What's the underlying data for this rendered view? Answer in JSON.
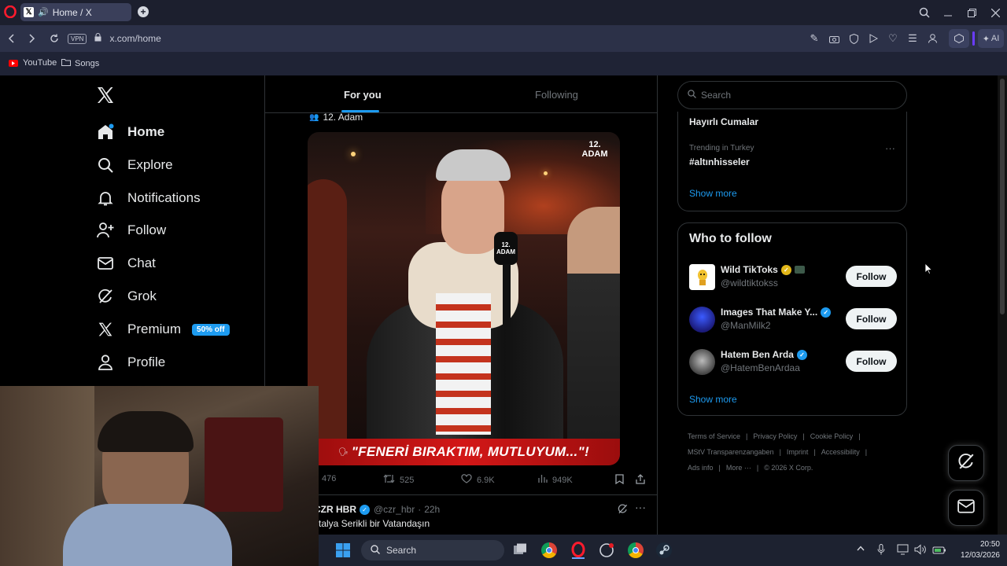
{
  "browser": {
    "tab_title": "Home / X",
    "url": "x.com/home",
    "vpn_label": "VPN",
    "ai_label": "AI",
    "bookmarks": [
      "YouTube",
      "Songs"
    ]
  },
  "sidebar": {
    "items": [
      {
        "label": "Home",
        "icon": "home-icon"
      },
      {
        "label": "Explore",
        "icon": "search-icon"
      },
      {
        "label": "Notifications",
        "icon": "bell-icon"
      },
      {
        "label": "Follow",
        "icon": "follow-icon"
      },
      {
        "label": "Chat",
        "icon": "mail-icon"
      },
      {
        "label": "Grok",
        "icon": "grok-icon"
      },
      {
        "label": "Premium",
        "icon": "x-icon"
      },
      {
        "label": "Profile",
        "icon": "person-icon"
      }
    ],
    "premium_badge": "50% off"
  },
  "timeline": {
    "tabs": [
      "For you",
      "Following"
    ],
    "post": {
      "author_header": "12. Adam",
      "video_caption": "\"FENERİ BIRAKTIM, MUTLUYUM...\"!",
      "video_logo": "12. ADAM",
      "mic_logo": "12. ADAM",
      "replies": "476",
      "reposts": "525",
      "likes": "6.9K",
      "views": "949K"
    },
    "next_post": {
      "name": "CZR HBR",
      "handle": "@czr_hbr",
      "time": "22h",
      "text": "talya Serikli bir Vatandaşın"
    }
  },
  "right": {
    "search_placeholder": "Search",
    "trends": [
      {
        "context": "",
        "topic": "Hayırlı Cumalar"
      },
      {
        "context": "Trending in Turkey",
        "topic": "#altınhisseler"
      }
    ],
    "trends_show_more": "Show more",
    "who_to_follow_title": "Who to follow",
    "accounts": [
      {
        "name": "Wild TikToks",
        "handle": "@wildtiktokss",
        "follow": "Follow"
      },
      {
        "name": "Images That Make Y...",
        "handle": "@ManMilk2",
        "follow": "Follow"
      },
      {
        "name": "Hatem Ben Arda",
        "handle": "@HatemBenArdaa",
        "follow": "Follow"
      }
    ],
    "wtf_show_more": "Show more",
    "footer_row1": [
      "Terms of Service",
      "Privacy Policy",
      "Cookie Policy"
    ],
    "footer_row2": [
      "MStV Transparenzangaben",
      "Imprint",
      "Accessibility"
    ],
    "footer_row3": [
      "Ads info",
      "More ···",
      "© 2026 X Corp."
    ]
  },
  "taskbar": {
    "search": "Search",
    "time": "20:50",
    "date": "12/03/2026"
  }
}
